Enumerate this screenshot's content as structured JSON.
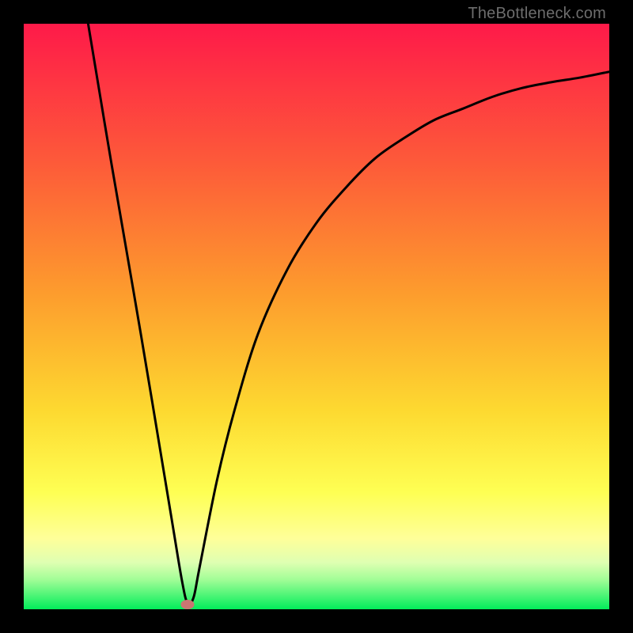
{
  "watermark": "TheBottleneck.com",
  "colors": {
    "frame": "#000000",
    "gradient_top": "#fe1a49",
    "gradient_mid1": "#fd8d2e",
    "gradient_mid2": "#fee635",
    "gradient_low": "#feff8d",
    "gradient_bottom": "#02ed5a",
    "curve": "#000000",
    "marker": "#cb7672"
  },
  "chart_data": {
    "type": "line",
    "title": "",
    "xlabel": "",
    "ylabel": "",
    "xlim": [
      0,
      100
    ],
    "ylim": [
      0,
      100
    ],
    "series": [
      {
        "name": "curve",
        "x": [
          11,
          15,
          20,
          25,
          27,
          28,
          29,
          30,
          33,
          36,
          40,
          45,
          50,
          55,
          60,
          65,
          70,
          75,
          80,
          85,
          90,
          95,
          100
        ],
        "values": [
          100,
          76,
          47,
          17,
          5,
          1,
          2,
          7,
          22,
          34,
          47,
          58,
          66,
          72,
          77,
          80.5,
          83.5,
          85.5,
          87.5,
          89,
          90,
          90.8,
          91.8
        ]
      }
    ],
    "marker": {
      "x": 28,
      "y": 0.8
    },
    "annotations": [
      {
        "text": "TheBottleneck.com",
        "position": "top-right"
      }
    ]
  }
}
